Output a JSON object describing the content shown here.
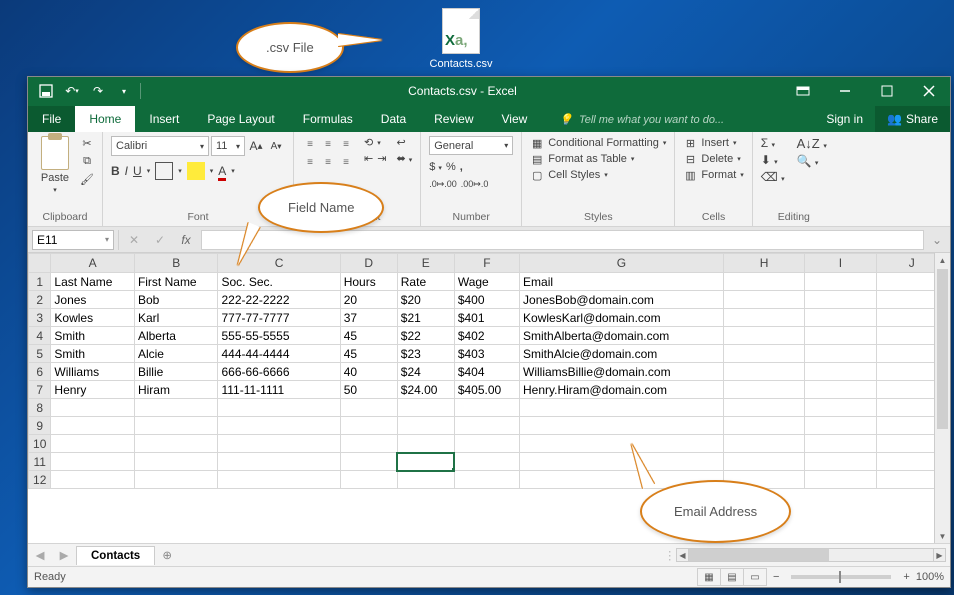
{
  "desktop": {
    "file_name": "Contacts.csv"
  },
  "callouts": {
    "csv": ".csv File",
    "field": "Field Name",
    "email": "Email Address"
  },
  "titlebar": {
    "title": "Contacts.csv - Excel"
  },
  "tabs": {
    "file": "File",
    "home": "Home",
    "insert": "Insert",
    "page_layout": "Page Layout",
    "formulas": "Formulas",
    "data": "Data",
    "review": "Review",
    "view": "View",
    "tell_me": "Tell me what you want to do...",
    "sign_in": "Sign in",
    "share": "Share"
  },
  "ribbon": {
    "clipboard": {
      "paste": "Paste",
      "label": "Clipboard"
    },
    "font": {
      "name": "Calibri",
      "size": "11",
      "label": "Font"
    },
    "alignment": {
      "label": "Alignment"
    },
    "number": {
      "format": "General",
      "label": "Number"
    },
    "styles": {
      "cond": "Conditional Formatting",
      "table": "Format as Table",
      "cell": "Cell Styles",
      "label": "Styles"
    },
    "cells": {
      "insert": "Insert",
      "delete": "Delete",
      "format": "Format",
      "label": "Cells"
    },
    "editing": {
      "label": "Editing"
    }
  },
  "fx": {
    "name_box": "E11"
  },
  "columns": [
    "A",
    "B",
    "C",
    "D",
    "E",
    "F",
    "G",
    "H",
    "I",
    "J"
  ],
  "headers": {
    "A": "Last Name",
    "B": "First Name",
    "C": "Soc. Sec.",
    "D": "Hours",
    "E": "Rate",
    "F": "Wage",
    "G": "Email"
  },
  "rows": [
    {
      "A": "Jones",
      "B": "Bob",
      "C": "222-22-2222",
      "D": "20",
      "E": "$20",
      "F": "$400",
      "G": "JonesBob@domain.com"
    },
    {
      "A": "Kowles",
      "B": "Karl",
      "C": "777-77-7777",
      "D": "37",
      "E": "$21",
      "F": "$401",
      "G": "KowlesKarl@domain.com"
    },
    {
      "A": "Smith",
      "B": "Alberta",
      "C": "555-55-5555",
      "D": "45",
      "E": "$22",
      "F": "$402",
      "G": "SmithAlberta@domain.com"
    },
    {
      "A": "Smith",
      "B": "Alcie",
      "C": "444-44-4444",
      "D": "45",
      "E": "$23",
      "F": "$403",
      "G": "SmithAlcie@domain.com"
    },
    {
      "A": "Williams",
      "B": "Billie",
      "C": "666-66-6666",
      "D": "40",
      "E": "$24",
      "F": "$404",
      "G": "WilliamsBillie@domain.com"
    },
    {
      "A": "Henry",
      "B": "Hiram",
      "C": "111-11-1111",
      "D": "50",
      "E": "$24.00",
      "F": "$405.00",
      "G": "Henry.Hiram@domain.com"
    }
  ],
  "selected_cell": "E11",
  "sheet_tab": "Contacts",
  "status": {
    "ready": "Ready",
    "zoom": "100%"
  },
  "chart_data": {
    "type": "table",
    "columns": [
      "Last Name",
      "First Name",
      "Soc. Sec.",
      "Hours",
      "Rate",
      "Wage",
      "Email"
    ],
    "rows": [
      [
        "Jones",
        "Bob",
        "222-22-2222",
        20,
        "$20",
        "$400",
        "JonesBob@domain.com"
      ],
      [
        "Kowles",
        "Karl",
        "777-77-7777",
        37,
        "$21",
        "$401",
        "KowlesKarl@domain.com"
      ],
      [
        "Smith",
        "Alberta",
        "555-55-5555",
        45,
        "$22",
        "$402",
        "SmithAlberta@domain.com"
      ],
      [
        "Smith",
        "Alcie",
        "444-44-4444",
        45,
        "$23",
        "$403",
        "SmithAlcie@domain.com"
      ],
      [
        "Williams",
        "Billie",
        "666-66-6666",
        40,
        "$24",
        "$404",
        "WilliamsBillie@domain.com"
      ],
      [
        "Henry",
        "Hiram",
        "111-11-1111",
        50,
        "$24.00",
        "$405.00",
        "Henry.Hiram@domain.com"
      ]
    ]
  }
}
